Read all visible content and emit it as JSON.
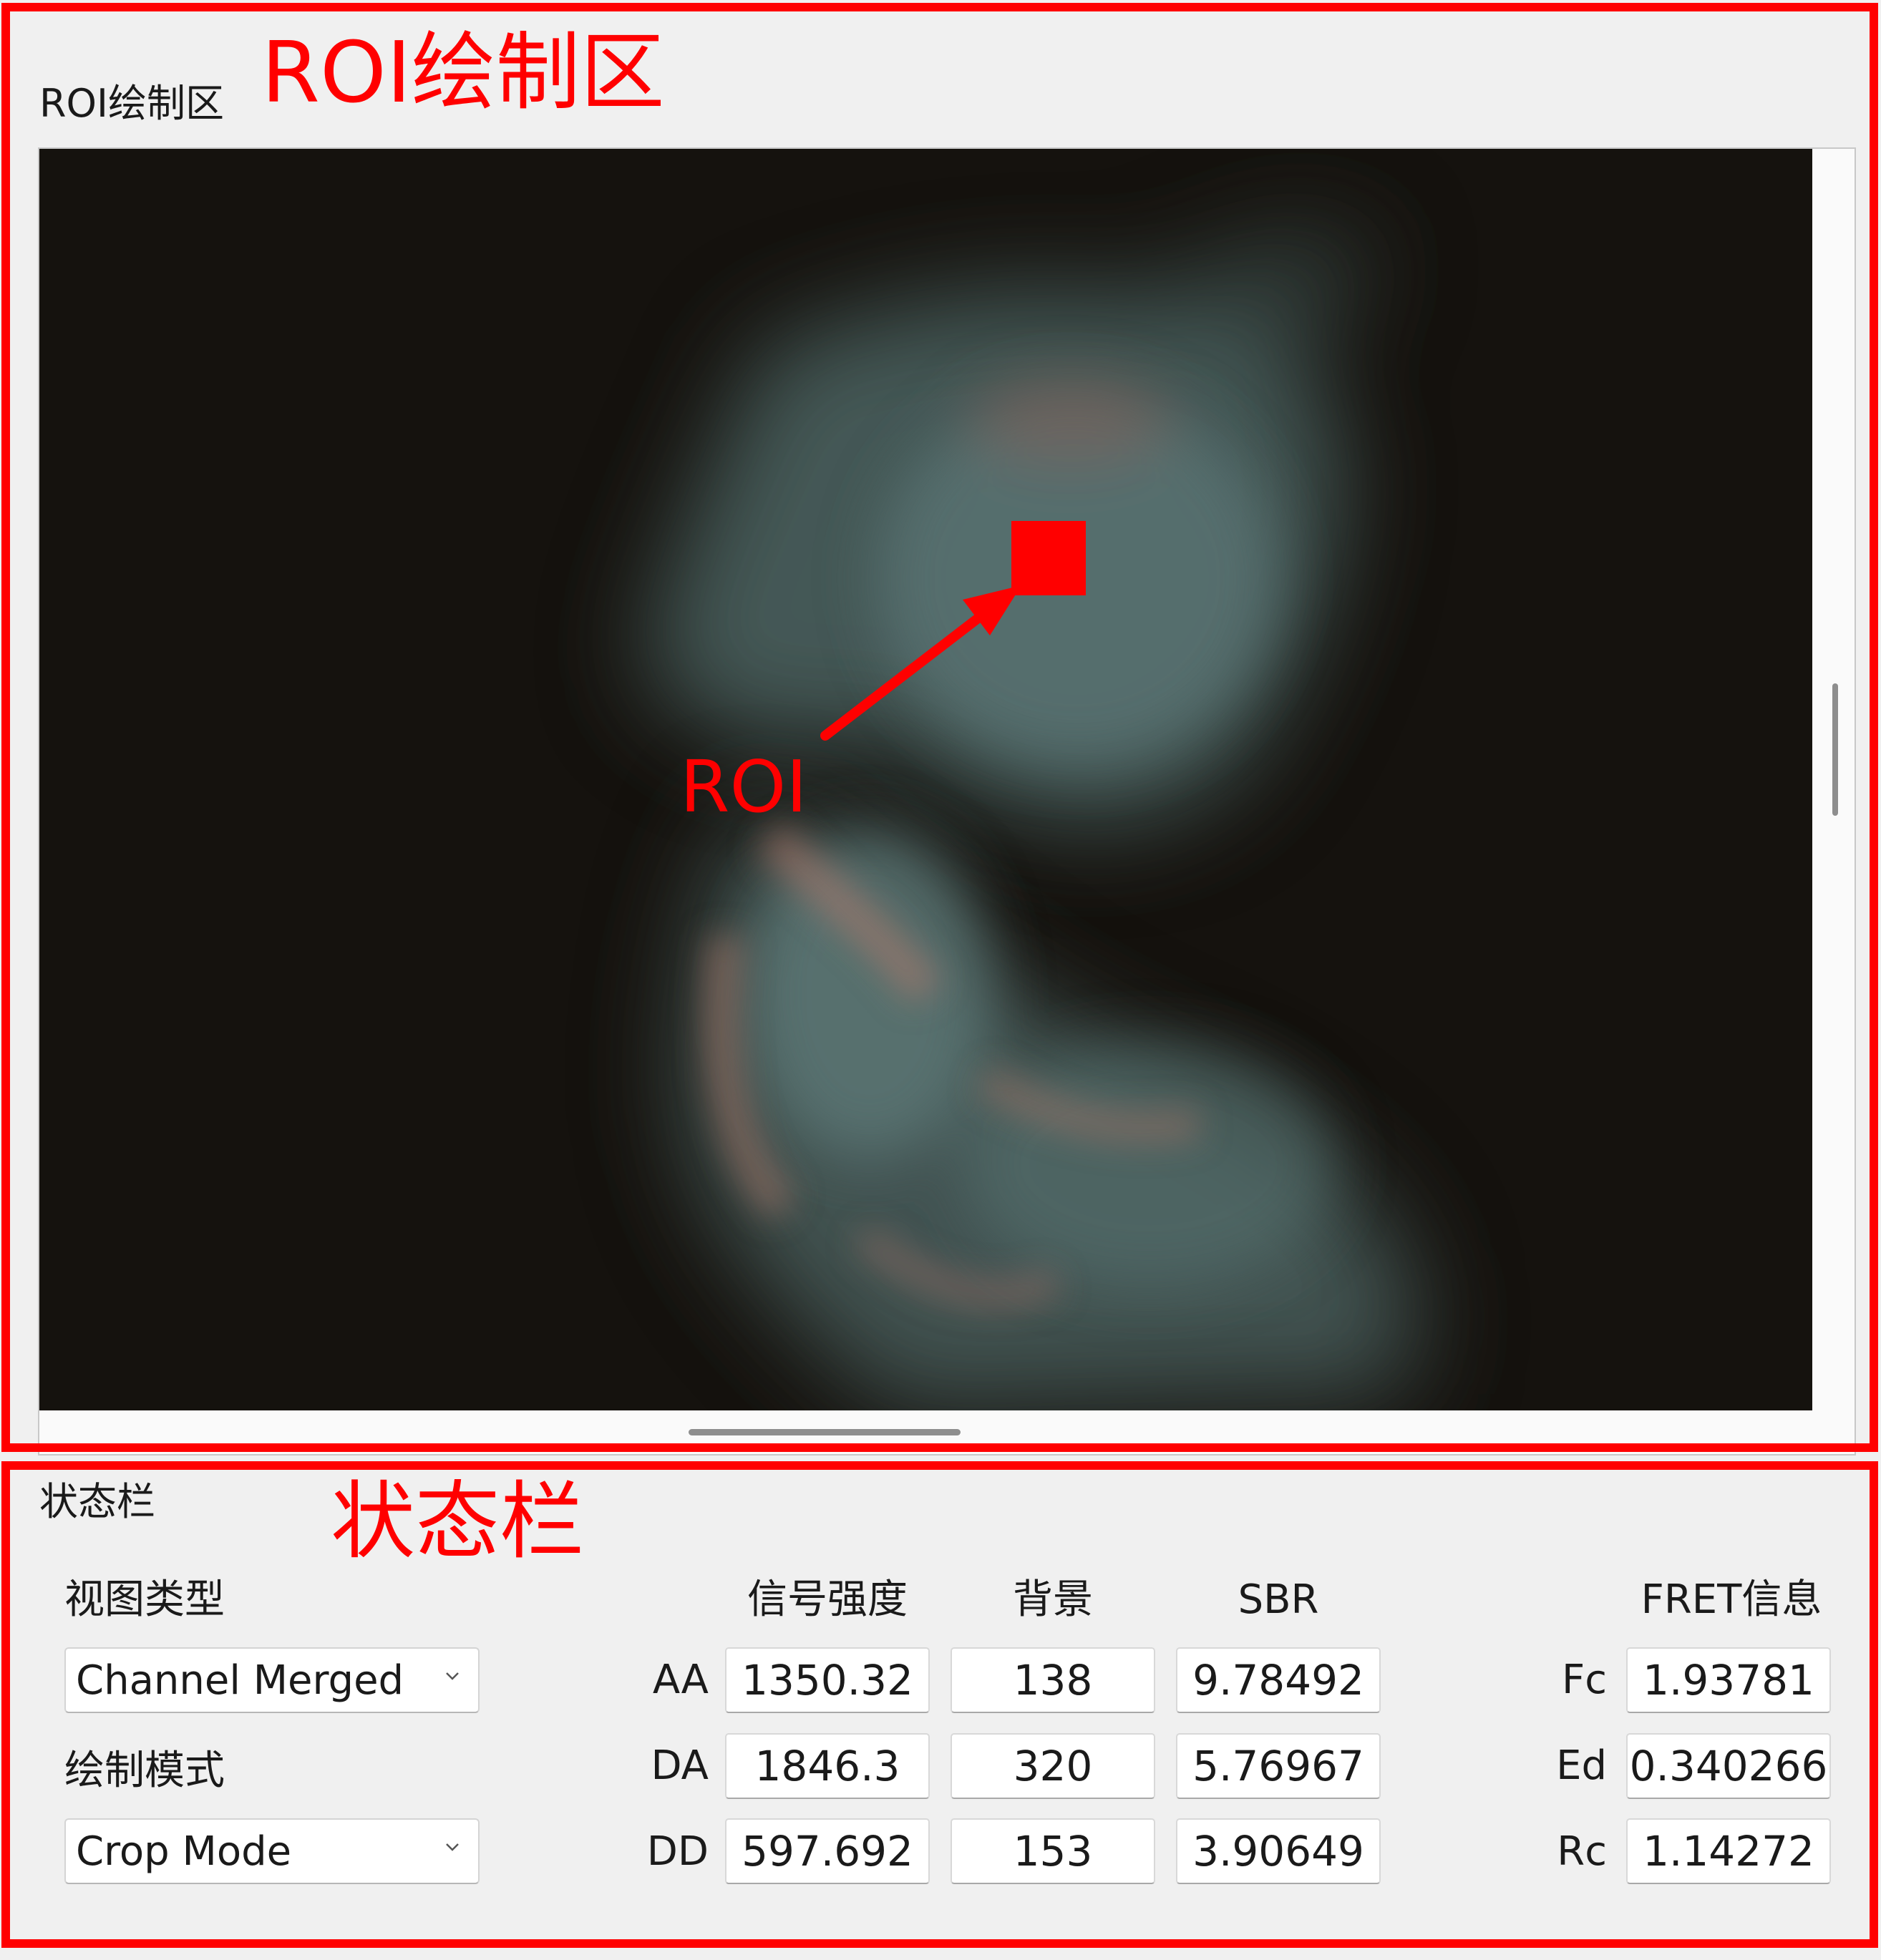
{
  "annotations": {
    "roi_area_title": "ROI绘制区",
    "status_bar_title": "状态栏",
    "roi_marker_label": "ROI",
    "color": "#ff0000"
  },
  "roi_panel": {
    "group_title": "ROI绘制区"
  },
  "status_panel": {
    "group_title": "状态栏",
    "view_type_label": "视图类型",
    "view_type_value": "Channel Merged",
    "draw_mode_label": "绘制模式",
    "draw_mode_value": "Crop Mode",
    "columns": {
      "signal": "信号强度",
      "background": "背景",
      "sbr": "SBR",
      "fret": "FRET信息"
    },
    "rows": [
      {
        "label": "AA",
        "signal": "1350.32",
        "background": "138",
        "sbr": "9.78492"
      },
      {
        "label": "DA",
        "signal": "1846.3",
        "background": "320",
        "sbr": "5.76967"
      },
      {
        "label": "DD",
        "signal": "597.692",
        "background": "153",
        "sbr": "3.90649"
      }
    ],
    "fret": [
      {
        "label": "Fc",
        "value": "1.93781"
      },
      {
        "label": "Ed",
        "value": "0.340266"
      },
      {
        "label": "Rc",
        "value": "1.14272"
      }
    ]
  },
  "icons": {
    "dropdown": "chevron-down-icon",
    "arrow": "arrow-icon"
  }
}
